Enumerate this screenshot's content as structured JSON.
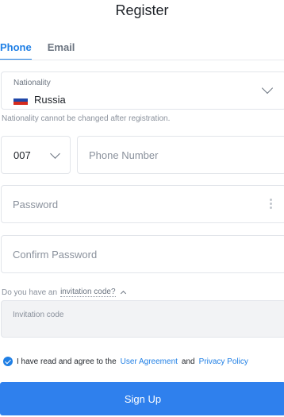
{
  "header": {
    "title": "Register"
  },
  "tabs": [
    {
      "label": "Phone",
      "active": true
    },
    {
      "label": "Email",
      "active": false
    }
  ],
  "nationality": {
    "label": "Nationality",
    "value": "Russia",
    "flag_colors": [
      "#ffffff",
      "#1f47a8",
      "#d52b1e"
    ],
    "hint": "Nationality cannot be changed after registration."
  },
  "phone": {
    "code": "007",
    "placeholder": "Phone Number",
    "value": ""
  },
  "password": {
    "placeholder": "Password",
    "value": ""
  },
  "confirm_password": {
    "placeholder": "Confirm Password",
    "value": ""
  },
  "invitation": {
    "prefix": "Do you have an",
    "link": "invitation code?",
    "placeholder": "Invitation code",
    "value": ""
  },
  "agreement": {
    "checked": true,
    "text": "I have read and agree to the",
    "user_agreement": "User Agreement",
    "and": "and",
    "privacy_policy": "Privacy Policy"
  },
  "submit": {
    "label": "Sign Up"
  },
  "colors": {
    "accent": "#1f7fe5",
    "button": "#2f80ed"
  }
}
